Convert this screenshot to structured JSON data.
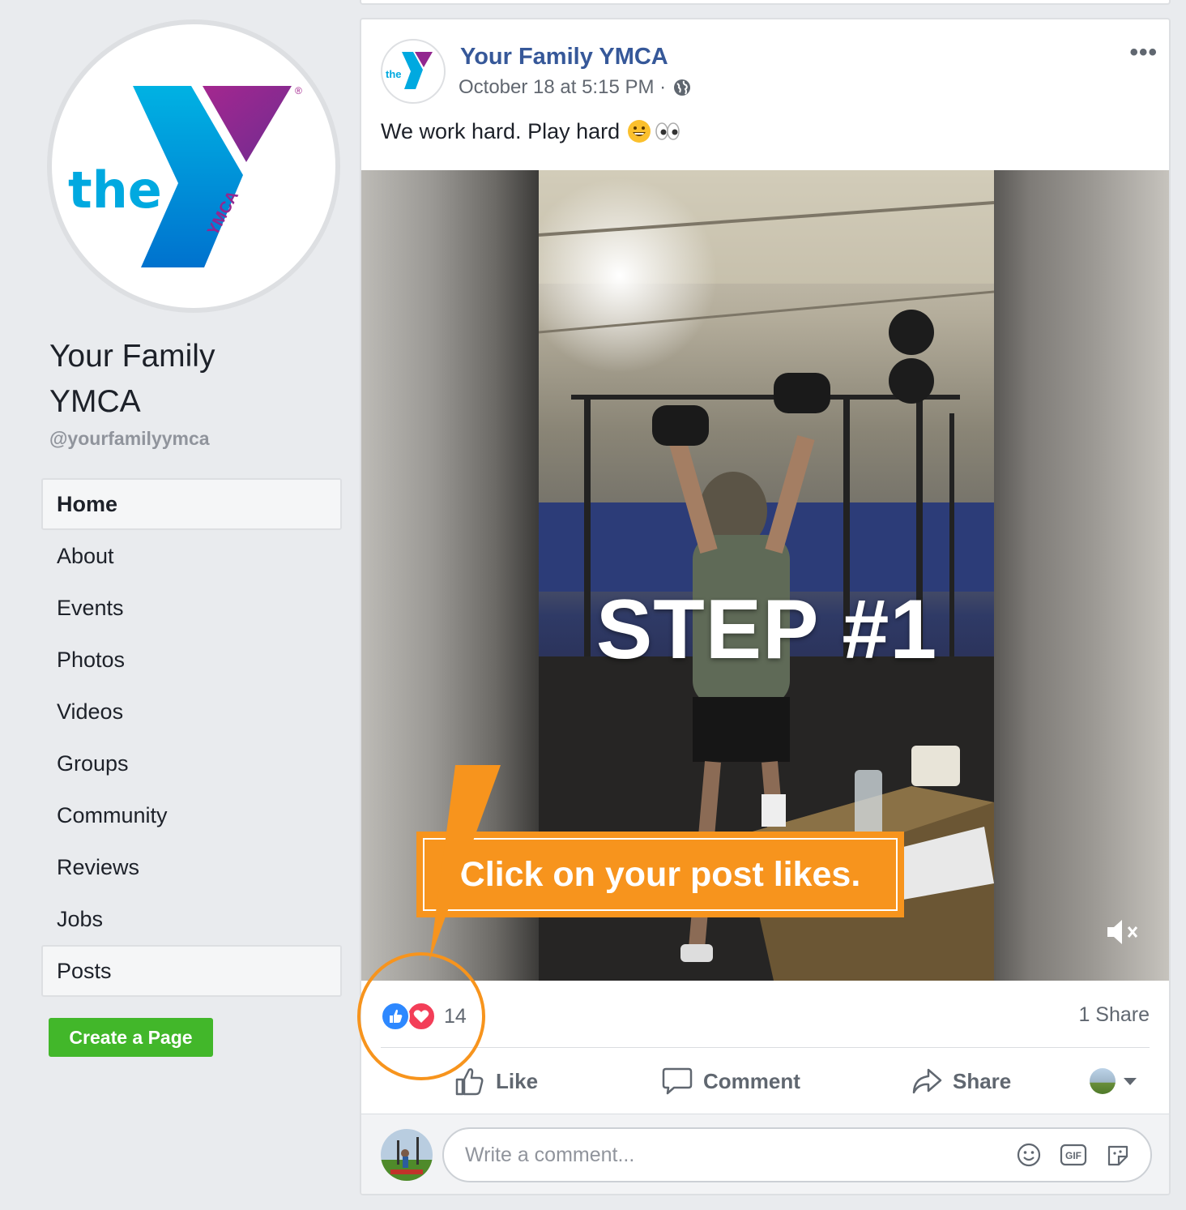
{
  "sidebar": {
    "page_name_line1": "Your Family",
    "page_name_line2": "YMCA",
    "handle": "@yourfamilyymca",
    "logo_text": "the",
    "logo_ymca": "YMCA",
    "nav": [
      {
        "label": "Home",
        "active": true
      },
      {
        "label": "About"
      },
      {
        "label": "Events"
      },
      {
        "label": "Photos"
      },
      {
        "label": "Videos"
      },
      {
        "label": "Groups"
      },
      {
        "label": "Community"
      },
      {
        "label": "Reviews"
      },
      {
        "label": "Jobs"
      },
      {
        "label": "Posts"
      }
    ],
    "create_page_label": "Create a Page"
  },
  "post": {
    "author": "Your Family YMCA",
    "timestamp": "October 18 at 5:15 PM ·",
    "text": "We work hard. Play hard",
    "more_label": "•••",
    "reaction_count": "14",
    "shares_label": "1 Share",
    "actions": {
      "like": "Like",
      "comment": "Comment",
      "share": "Share"
    },
    "comment_placeholder": "Write a comment...",
    "gif_label": "GIF"
  },
  "overlay": {
    "step_title": "STEP #1",
    "callout_text": "Click on your post likes."
  },
  "colors": {
    "brand_blue": "#365899",
    "like_blue": "#2d88ff",
    "love_red": "#f33e58",
    "callout_orange": "#f7941d",
    "create_green": "#42b72a",
    "ymca_blue": "#00a9e0",
    "ymca_purple": "#92278f"
  },
  "icons": [
    "globe-icon",
    "grin-emoji-icon",
    "eyes-emoji-icon",
    "mute-icon",
    "like-icon",
    "comment-icon",
    "share-icon",
    "caret-down-icon",
    "smiley-icon",
    "gif-icon",
    "sticker-icon"
  ]
}
